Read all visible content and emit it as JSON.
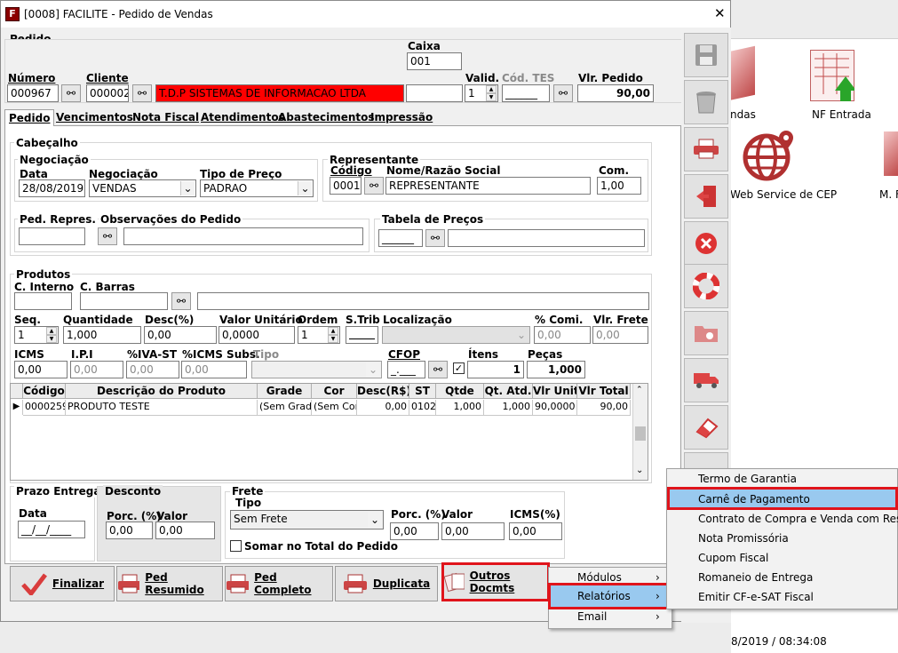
{
  "window": {
    "title": "[0008] FACILITE - Pedido de Vendas",
    "close": "✕"
  },
  "header": {
    "pedido": "Pedido",
    "caixa_label": "Caixa",
    "caixa_value": "001",
    "numero_label": "Número",
    "numero_value": "000967",
    "cliente_label": "Cliente",
    "cliente_code": "000002",
    "cliente_name": "T.D.P SISTEMAS DE INFORMACAO LTDA",
    "valid_label": "Valid.",
    "valid_value": "1",
    "cod_tes_label": "Cód. TES",
    "cod_tes_value": "______",
    "vlr_pedido_label": "Vlr. Pedido",
    "vlr_pedido_value": "90,00"
  },
  "tabs": [
    "Pedido",
    "Vencimentos",
    "Nota Fiscal",
    "Atendimentos",
    "Abastecimentos",
    "Impressão"
  ],
  "cabecalho": {
    "title": "Cabeçalho",
    "negociacao_group": "Negociação",
    "data_label": "Data",
    "data_value": "28/08/2019",
    "negociacao_label": "Negociação",
    "negociacao_value": "VENDAS",
    "tipo_preco_label": "Tipo de Preço",
    "tipo_preco_value": "PADRAO",
    "representante_group": "Representante",
    "codigo_label": "Código",
    "codigo_value": "0001",
    "nome_label": "Nome/Razão Social",
    "nome_value": "REPRESENTANTE",
    "com_label": "Com.",
    "com_value": "1,00",
    "ped_repres_label": "Ped. Repres.",
    "obs_label": "Observações do Pedido",
    "tabela_label": "Tabela de Preços",
    "tabela_value": "______"
  },
  "produtos": {
    "title": "Produtos",
    "c_interno": "C. Interno",
    "c_barras": "C. Barras",
    "seq_label": "Seq.",
    "seq_value": "1",
    "qtd_label": "Quantidade",
    "qtd_value": "1,000",
    "desc_label": "Desc(%)",
    "desc_value": "0,00",
    "vlr_unit_label": "Valor Unitário",
    "vlr_unit_value": "0,0000",
    "ordem_label": "Ordem",
    "ordem_value": "1",
    "strib_label": "S.Trib",
    "localizacao_label": "Localização",
    "comi_label": "% Comi.",
    "comi_value": "0,00",
    "frete_label": "Vlr. Frete",
    "frete_value": "0,00",
    "icms_label": "ICMS",
    "icms_value": "0,00",
    "ipi_label": "I.P.I",
    "ipi_value": "0,00",
    "iva_label": "%IVA-ST",
    "iva_value": "0,00",
    "icms_subs_label": "%ICMS Subs.",
    "icms_subs_value": "0,00",
    "tipo_label": "Tipo",
    "cfop_label": "CFOP",
    "cfop_value": "_.___",
    "itens_label": "Ítens",
    "itens_value": "1",
    "pecas_label": "Peças",
    "pecas_value": "1,000"
  },
  "grid": {
    "headers": [
      "Código",
      "Descrição do Produto",
      "Grade",
      "Cor",
      "Desc(R$)",
      "ST",
      "Qtde",
      "Qt. Atd.",
      "Vlr Unit",
      "Vlr Total"
    ],
    "row": [
      "0000259",
      "PRODUTO TESTE",
      "(Sem Grade",
      "(Sem Cor)",
      "0,00",
      "0102",
      "1,000",
      "1,000",
      "90,0000",
      "90,00"
    ]
  },
  "prazo": {
    "title": "Prazo Entrega",
    "data_label": "Data",
    "data_value": "__/__/____"
  },
  "desconto": {
    "title": "Desconto",
    "porc_label": "Porc. (%)",
    "porc_value": "0,00",
    "valor_label": "Valor",
    "valor_value": "0,00"
  },
  "frete": {
    "title": "Frete",
    "tipo_label": "Tipo",
    "tipo_value": "Sem Frete",
    "porc_label": "Porc. (%)",
    "porc_value": "0,00",
    "valor_label": "Valor",
    "valor_value": "0,00",
    "icms_label": "ICMS(%)",
    "icms_value": "0,00",
    "somar_label": "Somar no Total do Pedido"
  },
  "buttons": {
    "finalizar": "Finalizar",
    "ped_resumido": "Ped Resumido",
    "ped_completo": "Ped Completo",
    "duplicata": "Duplicata",
    "outros": "Outros Docmts"
  },
  "menu1": [
    "Módulos",
    "Relatórios",
    "Email"
  ],
  "menu2": [
    "Termo de Garantia",
    "Carnê de Pagamento",
    "Contrato de Compra e Venda com Reserva",
    "Nota Promissória",
    "Cupom Fiscal",
    "Romaneio de Entrega",
    "Emitir CF-e-SAT Fiscal"
  ],
  "desktop": {
    "icon1": "ndas",
    "icon2": "NF Entrada",
    "icon3": "Web Service de CEP",
    "icon4": "M. F",
    "status": "8/2019 / 08:34:08"
  },
  "colors": {
    "red": "#ff0000",
    "highlight": "#99c9ef",
    "red_box": "#e0141b"
  }
}
